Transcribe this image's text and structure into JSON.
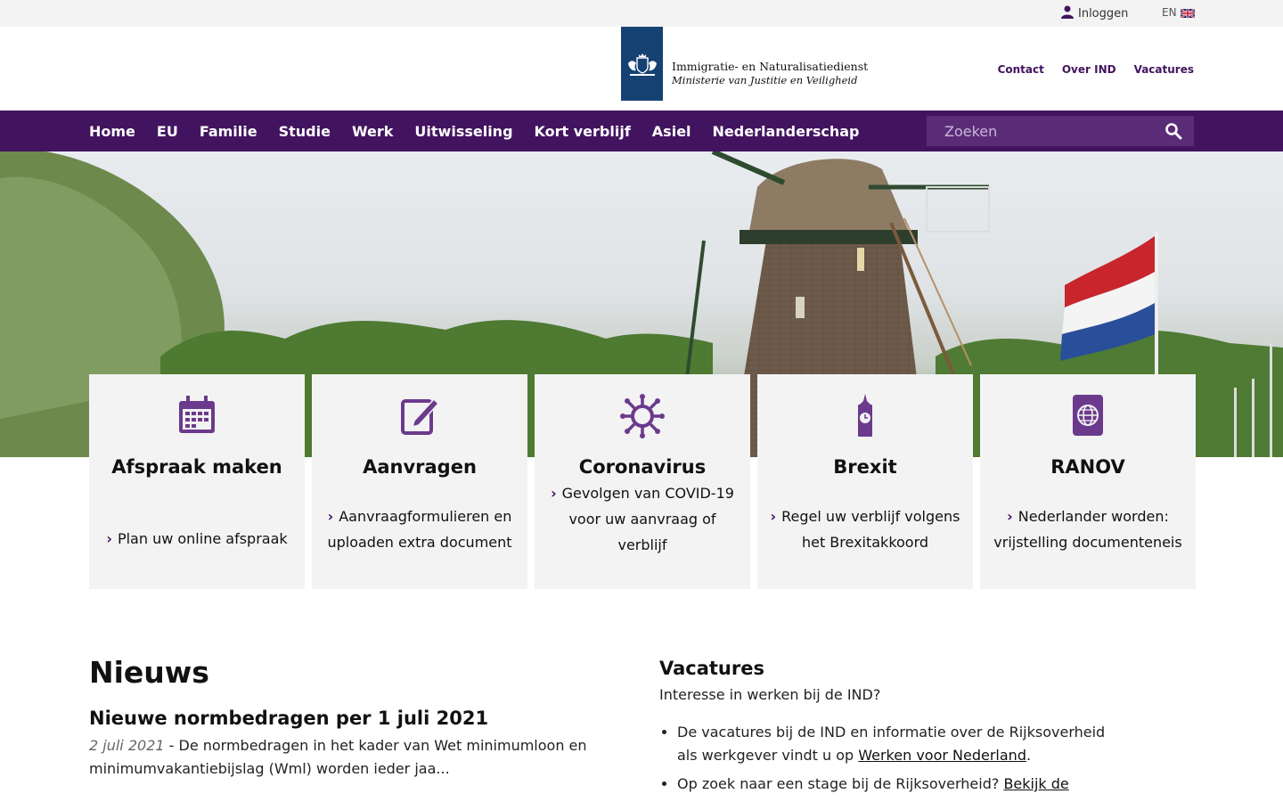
{
  "topbar": {
    "login_label": "Inloggen",
    "lang_label": "EN"
  },
  "header": {
    "org_name": "Immigratie- en Naturalisatiedienst",
    "ministry": "Ministerie van Justitie en Veiligheid",
    "links": [
      "Contact",
      "Over IND",
      "Vacatures"
    ]
  },
  "nav": {
    "items": [
      "Home",
      "EU",
      "Familie",
      "Studie",
      "Werk",
      "Uitwisseling",
      "Kort verblijf",
      "Asiel",
      "Nederlanderschap"
    ],
    "search_placeholder": "Zoeken"
  },
  "tiles": [
    {
      "title": "Afspraak maken",
      "link": "Plan uw online afspraak",
      "icon": "calendar-icon"
    },
    {
      "title": "Aanvragen",
      "link": "Aanvraagformulieren en uploaden extra document",
      "icon": "edit-icon"
    },
    {
      "title": "Coronavirus",
      "link": "Gevolgen van COVID-19 voor uw aanvraag of verblijf",
      "icon": "virus-icon"
    },
    {
      "title": "Brexit",
      "link": "Regel uw verblijf volgens het Brexitakkoord",
      "icon": "big-ben-icon"
    },
    {
      "title": "RANOV",
      "link": "Nederlander worden: vrijstelling documenteneis",
      "icon": "passport-icon"
    }
  ],
  "news": {
    "heading": "Nieuws",
    "item_title": "Nieuwe normbedragen per 1 juli 2021",
    "item_date": "2 juli 2021",
    "item_text": " - De normbedragen in het kader van Wet minimumloon en minimumvakantiebijslag (Wml) worden ieder jaa..."
  },
  "vacatures": {
    "heading": "Vacatures",
    "intro": "Interesse in werken bij de IND?",
    "bullet1_text": "De vacatures bij de IND en informatie over de Rijksoverheid als werkgever vindt u op ",
    "bullet1_link": "Werken voor Nederland",
    "bullet1_end": ".",
    "bullet2_text": "Op zoek naar een stage bij de Rijksoverheid? ",
    "bullet2_link": "Bekijk de"
  },
  "colors": {
    "brand_purple": "#42145f",
    "logo_blue": "#154273",
    "tile_bg": "#f3f3f3"
  }
}
